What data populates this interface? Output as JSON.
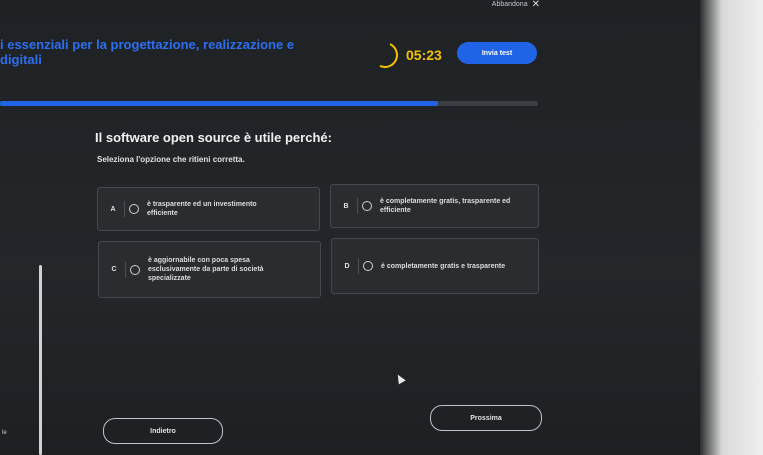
{
  "header": {
    "abandon_label": "Abbandona",
    "close_icon": "close-icon",
    "course_title_line1": "i essenziali per la progettazione, realizzazione e",
    "course_title_line2": "digitali",
    "timer": "05:23",
    "submit_label": "Invia test"
  },
  "progress": {
    "fraction": 0.815
  },
  "question": {
    "text": "Il software open source è utile perché:",
    "instruction": "Seleziona l'opzione che ritieni corretta.",
    "options": [
      {
        "letter": "A",
        "text": "è trasparente ed un investimento\nefficiente"
      },
      {
        "letter": "B",
        "text": "è completamente gratis, trasparente ed\nefficiente"
      },
      {
        "letter": "C",
        "text": "è aggiornabile con poca spesa\nesclusivamente da parte di società\nspecializzate"
      },
      {
        "letter": "D",
        "text": "è completamente gratis e trasparente"
      }
    ]
  },
  "nav": {
    "next_label": "Prossima",
    "back_label": "Indietro"
  },
  "misc": {
    "edge_label": "le"
  },
  "colors": {
    "accent": "#1f63e6",
    "timer": "#f2c200"
  }
}
